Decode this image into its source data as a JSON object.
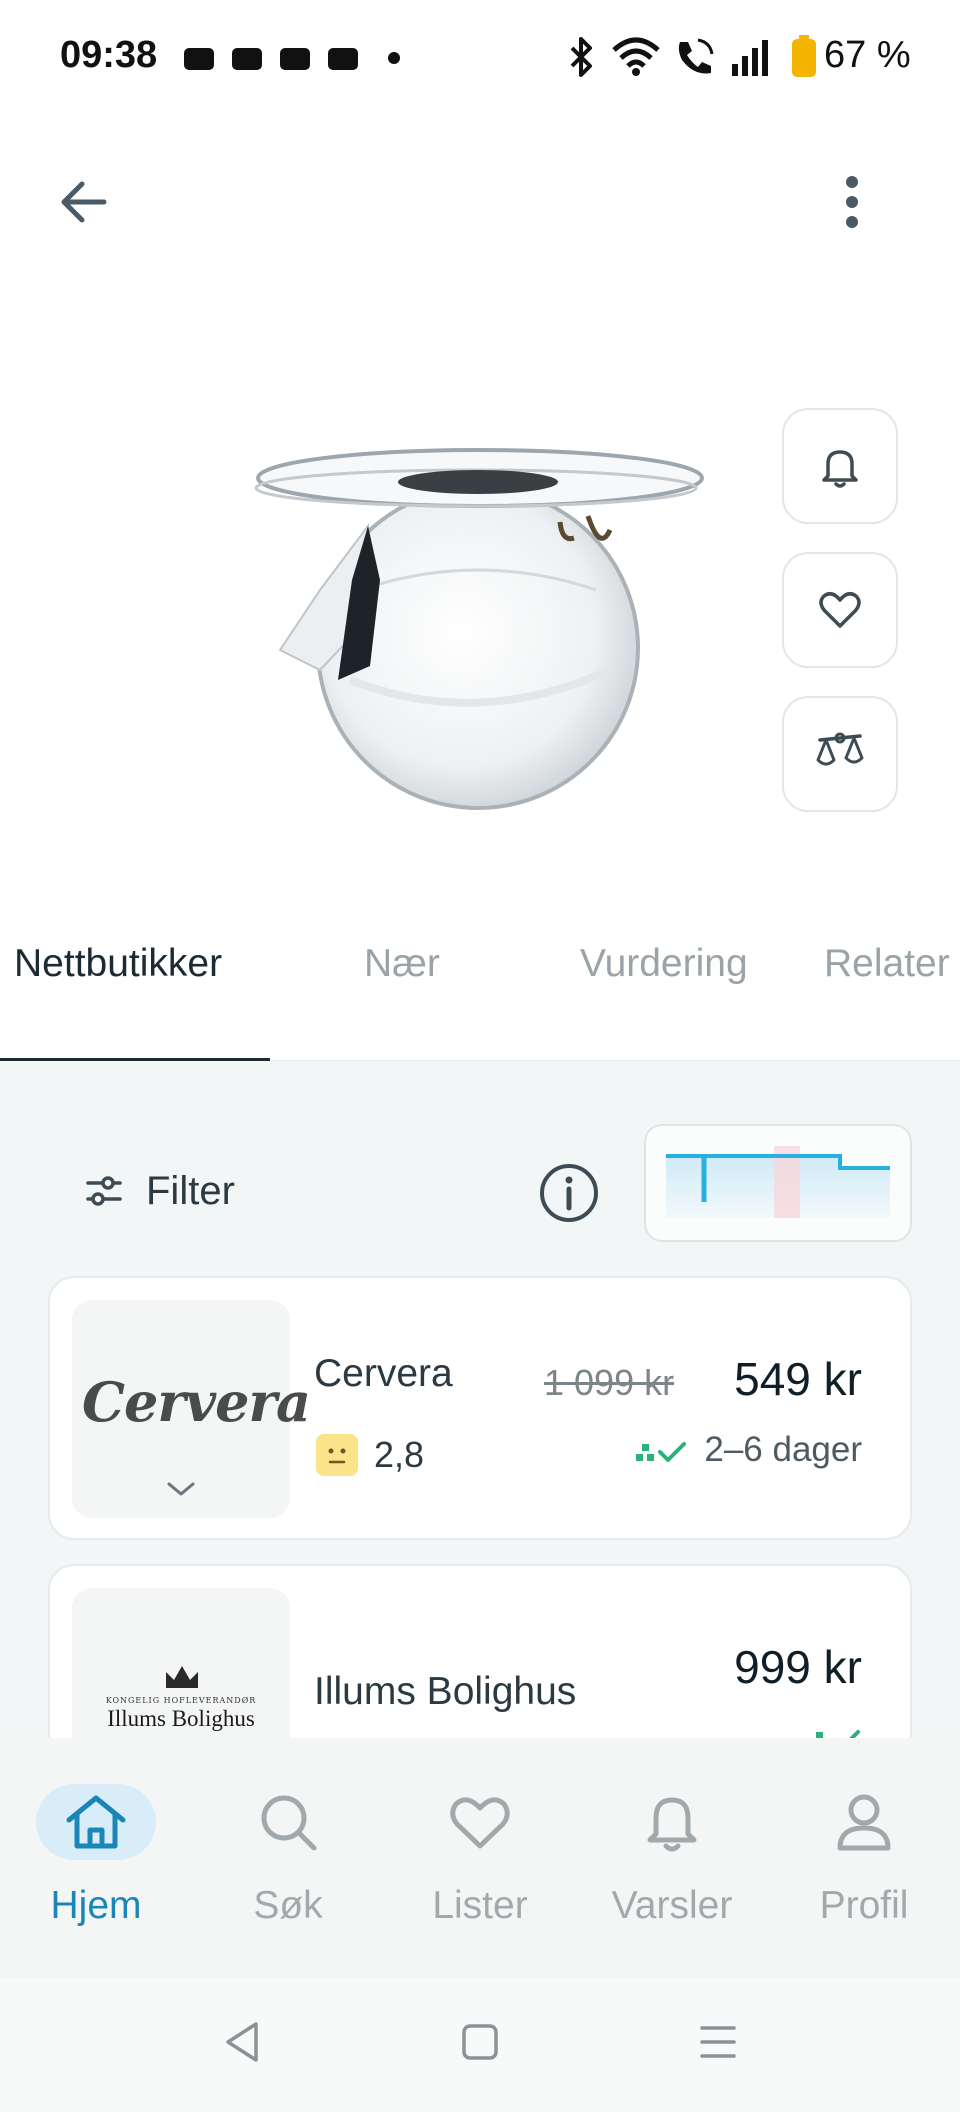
{
  "status_bar": {
    "time": "09:38",
    "battery_percent": "67 %",
    "icons": [
      "notification-icon",
      "bluetooth-icon",
      "wifi-icon",
      "wifi-call-icon",
      "signal-icon",
      "battery-icon"
    ]
  },
  "top_bar": {
    "icons": [
      "arrow-left-icon",
      "more-vertical-icon"
    ]
  },
  "product": {
    "image": "glass-vase-image",
    "actions": [
      "bell-icon",
      "heart-icon",
      "scale-icon"
    ]
  },
  "tabs": [
    {
      "label": "Nettbutikker",
      "active": true
    },
    {
      "label": "Nær",
      "active": false
    },
    {
      "label": "Vurdering",
      "active": false
    },
    {
      "label": "Relater",
      "active": false
    }
  ],
  "filter_bar": {
    "filter_label": "Filter",
    "icons": [
      "sliders-icon",
      "info-icon",
      "price-history-chart"
    ]
  },
  "offers": [
    {
      "store": "Cervera",
      "logo_text": "Cervera",
      "rating": "2,8",
      "old_price": "1 099 kr",
      "price": "549 kr",
      "delivery": "2–6 dager"
    },
    {
      "store": "Illums Bolighus",
      "logo_text": "Illums Bolighus",
      "logo_subtext": "KONGELIG HOFLEVERANDØR",
      "price": "999 kr"
    }
  ],
  "bottom_nav": [
    {
      "label": "Hjem",
      "icon": "home-icon",
      "active": true
    },
    {
      "label": "Søk",
      "icon": "search-icon",
      "active": false
    },
    {
      "label": "Lister",
      "icon": "heart-icon",
      "active": false
    },
    {
      "label": "Varsler",
      "icon": "bell-icon",
      "active": false
    },
    {
      "label": "Profil",
      "icon": "user-icon",
      "active": false
    }
  ],
  "colors": {
    "accent": "#1a86b8",
    "accent_bg": "#d8edf7",
    "text_primary": "#1c2a33",
    "text_muted": "#9aa3a8",
    "delivery_green": "#2bb27a",
    "rating_yellow": "#fbe38a"
  }
}
